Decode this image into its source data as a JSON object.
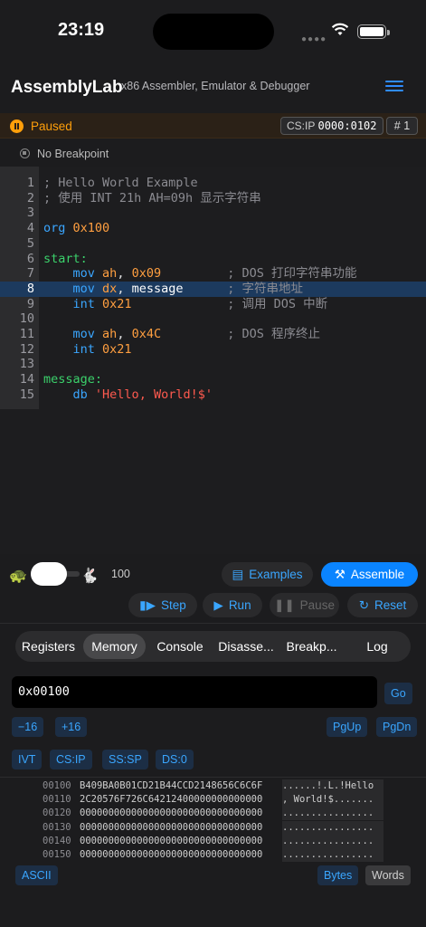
{
  "status_bar": {
    "time": "23:19"
  },
  "header": {
    "title": "AssemblyLab",
    "subtitle": "x86 Assembler, Emulator & Debugger"
  },
  "execution": {
    "state": "Paused",
    "csip_label": "CS:IP",
    "csip_value": "0000:0102",
    "breakpoint_label": "#",
    "breakpoint_count": "1",
    "breakpoint_status": "No Breakpoint"
  },
  "editor": {
    "active_line": 8,
    "lines": [
      {
        "n": "1",
        "html": "<span class=\"c-comment\">; Hello World Example</span>"
      },
      {
        "n": "2",
        "html": "<span class=\"c-comment\">; 使用 INT 21h AH=09h 显示字符串</span>"
      },
      {
        "n": "3",
        "html": ""
      },
      {
        "n": "4",
        "html": "<span class=\"c-kw\">org</span> <span class=\"c-num\">0x100</span>"
      },
      {
        "n": "5",
        "html": ""
      },
      {
        "n": "6",
        "html": "<span class=\"c-label\">start:</span>"
      },
      {
        "n": "7",
        "html": "    <span class=\"c-kw\">mov</span> <span class=\"c-num\">ah</span>, <span class=\"c-num\">0x09</span>         <span class=\"c-comment\">; DOS 打印字符串功能</span>"
      },
      {
        "n": "8",
        "html": "    <span class=\"c-kw\">mov</span> <span class=\"c-num\">dx</span>, <span class=\"c-id\">message</span>      <span class=\"c-comment\">; 字符串地址</span>"
      },
      {
        "n": "9",
        "html": "    <span class=\"c-kw\">int</span> <span class=\"c-num\">0x21</span>             <span class=\"c-comment\">; 调用 DOS 中断</span>"
      },
      {
        "n": "10",
        "html": ""
      },
      {
        "n": "11",
        "html": "    <span class=\"c-kw\">mov</span> <span class=\"c-num\">ah</span>, <span class=\"c-num\">0x4C</span>         <span class=\"c-comment\">; DOS 程序终止</span>"
      },
      {
        "n": "12",
        "html": "    <span class=\"c-kw\">int</span> <span class=\"c-num\">0x21</span>"
      },
      {
        "n": "13",
        "html": ""
      },
      {
        "n": "14",
        "html": "<span class=\"c-label\">message:</span>"
      },
      {
        "n": "15",
        "html": "    <span class=\"c-kw\">db</span> <span class=\"c-str\">'Hello, World!$'</span>"
      }
    ]
  },
  "controls": {
    "speed_value": "100",
    "speed_fraction": 0.8,
    "examples_label": "Examples",
    "assemble_label": "Assemble",
    "step_label": "Step",
    "run_label": "Run",
    "pause_label": "Pause",
    "reset_label": "Reset"
  },
  "tabs": [
    {
      "label": "Registers",
      "active": false
    },
    {
      "label": "Memory",
      "active": true
    },
    {
      "label": "Console",
      "active": false
    },
    {
      "label": "Disasse...",
      "active": false
    },
    {
      "label": "Breakp...",
      "active": false
    },
    {
      "label": "Log",
      "active": false
    }
  ],
  "memory": {
    "address": "0x00100",
    "go_label": "Go",
    "minus16_label": "−16",
    "plus16_label": "+16",
    "pgup_label": "PgUp",
    "pgdn_label": "PgDn",
    "ivt_label": "IVT",
    "csip_label": "CS:IP",
    "sssp_label": "SS:SP",
    "ds_label": "DS:0",
    "rows": [
      {
        "addr": "00100",
        "hex": "B409BA0B01CD21B44CCD2148656C6C6F",
        "ascii": "......!.L.!Hello"
      },
      {
        "addr": "00110",
        "hex": "2C20576F726C64212400000000000000",
        "ascii": ", World!$......."
      },
      {
        "addr": "00120",
        "hex": "00000000000000000000000000000000",
        "ascii": "................"
      },
      {
        "addr": "00130",
        "hex": "00000000000000000000000000000000",
        "ascii": "................"
      },
      {
        "addr": "00140",
        "hex": "00000000000000000000000000000000",
        "ascii": "................"
      },
      {
        "addr": "00150",
        "hex": "00000000000000000000000000000000",
        "ascii": "................"
      }
    ],
    "ascii_label": "ASCII",
    "bytes_label": "Bytes",
    "words_label": "Words"
  },
  "colors": {
    "accent": "#0a84ff",
    "paused": "#ff9f0a",
    "active_line": "#1c3a5e"
  }
}
